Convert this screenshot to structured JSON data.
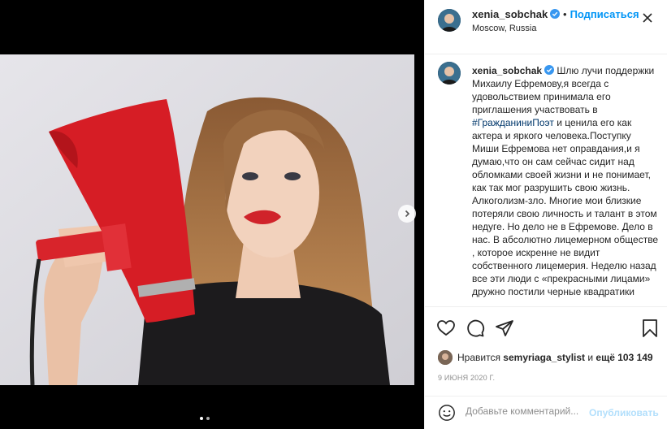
{
  "post": {
    "username": "xenia_sobchak",
    "follow_separator": "•",
    "follow_label": "Подписаться",
    "location": "Moscow, Russia",
    "more_icon": "ellipsis-icon"
  },
  "media": {
    "carousel_next_icon": "chevron-right-icon",
    "dots_count": 2
  },
  "caption": {
    "username": "xenia_sobchak",
    "text_before": "Шлю лучи поддержки Михаилу Ефремову,я всегда с удовольствием принимала его приглашения участвовать в ",
    "hashtag": "#ГражданиниПоэт",
    "text_after": " и ценила его как актера и яркого человека.Поступку Миши Ефремова нет оправдания,и я думаю,что он сам сейчас сидит над обломками своей жизни и не понимает, как так мог разрушить свою жизнь. Алкоголизм-зло. Многие мои близкие потеряли свою личность и талант в этом недуге. Но дело не в Ефремове. Дело в нас. В абсолютно лицемерном обществе , которое искренне не видит собственного лицемерия. Неделю назад все эти люди с «прекрасными лицами» дружно постили черные квадратики"
  },
  "actions": {
    "like_icon": "heart-icon",
    "comment_icon": "comment-icon",
    "share_icon": "share-icon",
    "save_icon": "bookmark-icon"
  },
  "likes": {
    "prefix": "Нравится",
    "user": "semyriaga_stylist",
    "conjunction": "и",
    "rest": "ещё 103 149"
  },
  "date": "9 ИЮНЯ 2020 Г.",
  "comment_box": {
    "emoji_icon": "emoji-icon",
    "placeholder": "Добавьте комментарий...",
    "publish_label": "Опубликовать"
  },
  "colors": {
    "link_blue": "#0095f6",
    "publish_disabled": "#b2dffc",
    "hashtag": "#00376b",
    "muted": "#8e8e8e"
  }
}
